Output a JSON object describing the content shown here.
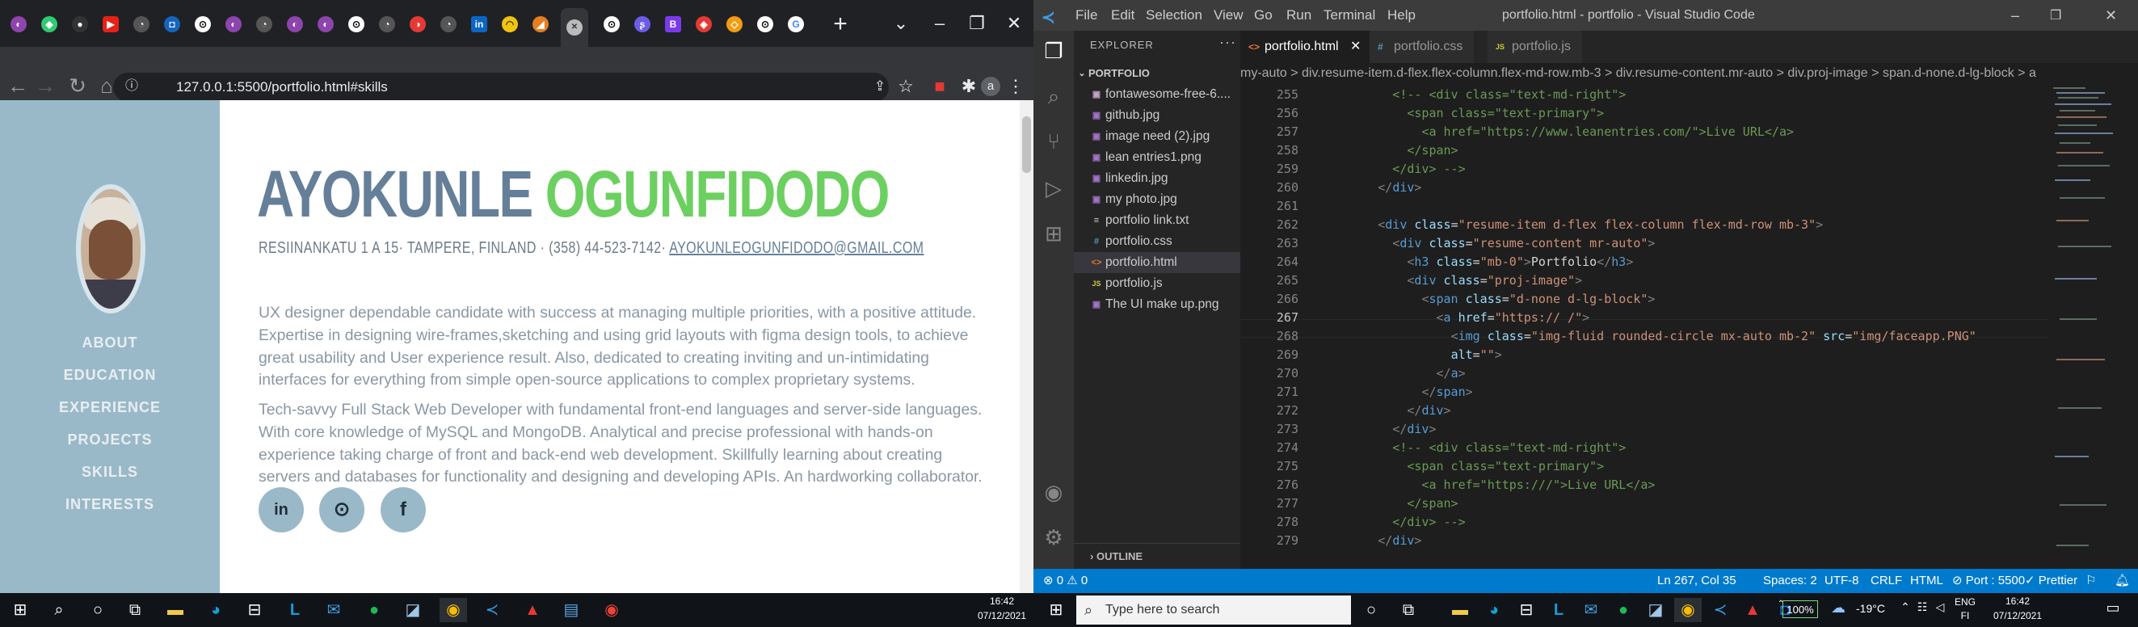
{
  "browser": {
    "url": "127.0.0.1:5500/portfolio.html#skills",
    "profile_initial": "a",
    "name_first": "AYOKUNLE",
    "name_last": "OGUNFIDODO",
    "address": "RESIINANKATU 1 A 15· TAMPERE, FINLAND · (358) 44-523-7142·",
    "email": "AYOKUNLEOGUNFIDODO@GMAIL.COM",
    "paragraph1": "UX designer dependable candidate with success at managing multiple priorities, with a positive attitude. Expertise in designing wire-frames,sketching and using grid layouts with figma design tools, to achieve great usability and User experience result. Also, dedicated to creating inviting and un-intimidating interfaces for everything from simple open-source applications to complex proprietary systems.",
    "paragraph2": "Tech-savvy Full Stack Web Developer with fundamental front-end languages and server-side languages. With core knowledge of MySQL and MongoDB. Analytical and precise professional with hands-on experience taking charge of front and back-end web development. Skillfully learning about creating servers and databases for functionality and designing and developing APIs. An hardworking collaborator.",
    "nav": [
      "ABOUT",
      "EDUCATION",
      "EXPERIENCE",
      "PROJECTS",
      "SKILLS",
      "INTERESTS"
    ],
    "social": [
      "in",
      "gh",
      "f"
    ]
  },
  "vscode": {
    "menu": [
      "File",
      "Edit",
      "Selection",
      "View",
      "Go",
      "Run",
      "Terminal",
      "Help"
    ],
    "title": "portfolio.html - portfolio - Visual Studio Code",
    "explorer_header": "EXPLORER",
    "folder": "PORTFOLIO",
    "files": [
      {
        "name": "fontawesome-free-6....",
        "icon": "▣",
        "color": "#c5a5c5"
      },
      {
        "name": "github.jpg",
        "icon": "▣",
        "color": "#a074c4"
      },
      {
        "name": "image need (2).jpg",
        "icon": "▣",
        "color": "#a074c4"
      },
      {
        "name": "lean entries1.png",
        "icon": "▣",
        "color": "#a074c4"
      },
      {
        "name": "linkedin.jpg",
        "icon": "▣",
        "color": "#a074c4"
      },
      {
        "name": "my photo.jpg",
        "icon": "▣",
        "color": "#a074c4"
      },
      {
        "name": "portfolio link.txt",
        "icon": "≡",
        "color": "#cccccc"
      },
      {
        "name": "portfolio.css",
        "icon": "#",
        "color": "#519aba"
      },
      {
        "name": "portfolio.html",
        "icon": "<>",
        "color": "#e37933"
      },
      {
        "name": "portfolio.js",
        "icon": "JS",
        "color": "#cbcb41"
      },
      {
        "name": "The UI make up.png",
        "icon": "▣",
        "color": "#a074c4"
      }
    ],
    "outline_label": "OUTLINE",
    "tabs": [
      "portfolio.html",
      "portfolio.css",
      "portfolio.js"
    ],
    "breadcrumbs": "my-auto  >  div.resume-item.d-flex.flex-column.flex-md-row.mb-3  >  div.resume-content.mr-auto  >  div.proj-image  >  span.d-none.d-lg-block  >  a",
    "line_numbers": [
      "255",
      "256",
      "257",
      "258",
      "259",
      "260",
      "261",
      "262",
      "263",
      "264",
      "265",
      "266",
      "267",
      "268",
      "269",
      "270",
      "271",
      "272",
      "273",
      "274",
      "275",
      "276",
      "277",
      "278",
      "279"
    ],
    "status": {
      "errors": "⊗ 0 ⚠ 0",
      "position": "Ln 267, Col 35",
      "spaces": "Spaces: 2",
      "encoding": "UTF-8",
      "eol": "CRLF",
      "language": "HTML",
      "port": "⊘ Port : 5500",
      "prettier": "✓ Prettier"
    }
  },
  "taskbar": {
    "search_placeholder": "Type here to search",
    "left_time": "16:42",
    "left_date": "07/12/2021",
    "battery": "100%",
    "temperature": "-19°C",
    "lang1": "ENG",
    "lang2": "FI",
    "right_time": "16:42",
    "right_date": "07/12/2021"
  }
}
